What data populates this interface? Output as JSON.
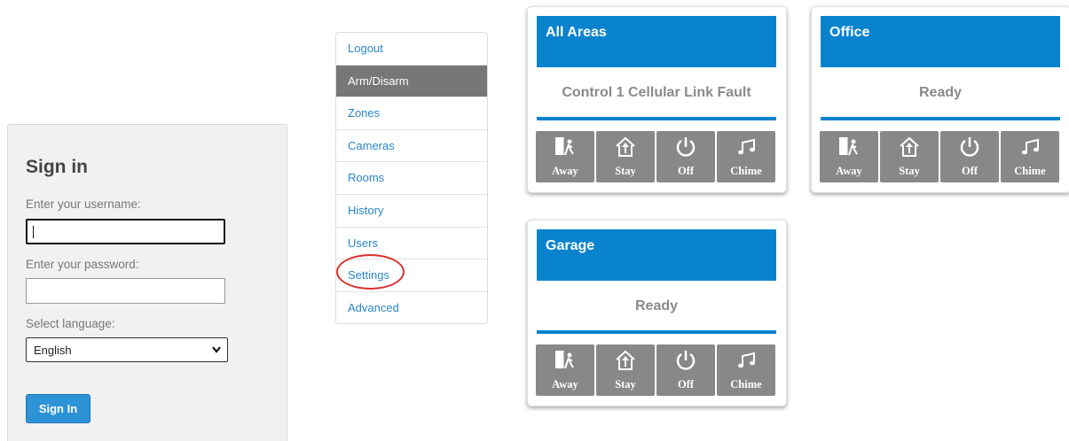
{
  "signin": {
    "title": "Sign in",
    "username_label": "Enter your username:",
    "username_value": "",
    "password_label": "Enter your password:",
    "password_value": "",
    "language_label": "Select language:",
    "language_selected": "English",
    "button_label": "Sign In"
  },
  "nav": {
    "items": [
      {
        "label": "Logout"
      },
      {
        "label": "Arm/Disarm",
        "active": true
      },
      {
        "label": "Zones"
      },
      {
        "label": "Cameras"
      },
      {
        "label": "Rooms"
      },
      {
        "label": "History"
      },
      {
        "label": "Users"
      },
      {
        "label": "Settings",
        "highlighted": true
      },
      {
        "label": "Advanced"
      }
    ]
  },
  "areas": [
    {
      "name": "All Areas",
      "status": "Control 1 Cellular Link Fault"
    },
    {
      "name": "Office",
      "status": "Ready"
    },
    {
      "name": "Garage",
      "status": "Ready"
    }
  ],
  "actions": {
    "away": "Away",
    "stay": "Stay",
    "off": "Off",
    "chime": "Chime"
  },
  "colors": {
    "accent": "#0a83cf",
    "nav_active": "#777777",
    "action_button": "#888888",
    "link": "#2a86c9",
    "highlight_circle": "#d9302b"
  }
}
